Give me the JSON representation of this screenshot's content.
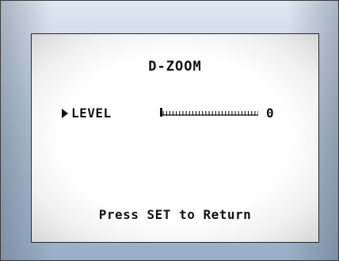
{
  "menu": {
    "title": "D-ZOOM",
    "item_label": "LEVEL",
    "level_value": "0",
    "level_fraction": 0.0,
    "footer_hint": "Press SET to Return"
  },
  "icons": {
    "cursor": "right-triangle-icon"
  },
  "colors": {
    "text": "#111111",
    "screen_bg": "#ffffff",
    "frame_bg": "#b9c9da"
  }
}
